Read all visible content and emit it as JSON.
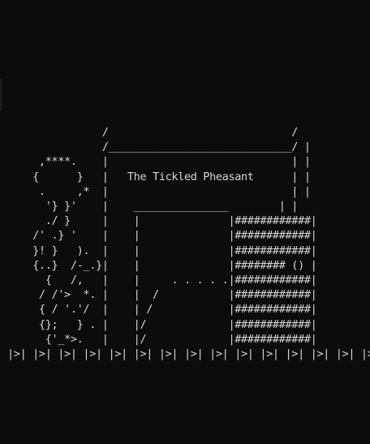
{
  "scene": {
    "art_lines": [
      "               /                             /",
      "               /_____________________________/ |",
      "     ,****.    |                             | |",
      "    {      }   |   The Tickled Pheasant      | |",
      "     .     ,*  |                             | |",
      "      '} }'    |    _______________        | |",
      "      ./ }     |    |              |############|",
      "    /' .} '    |    |              |############|",
      "    }! }   ).  |    |              |############|",
      "    {..}  /-_.}|    |              |######## () |",
      "      {   /,   |    |     . . . . .|############|",
      "     / /'>  *. |    |  /           |############|",
      "     { / '.'/  |    | /            |############|",
      "     {};   } . |    |/             |############|",
      "      {'_*>.   |    |/             |############|",
      "|>| |>| |>| |>| |>| |>| |>| |>| |>| |>| |>| |>| |>| |>| |>"
    ]
  }
}
